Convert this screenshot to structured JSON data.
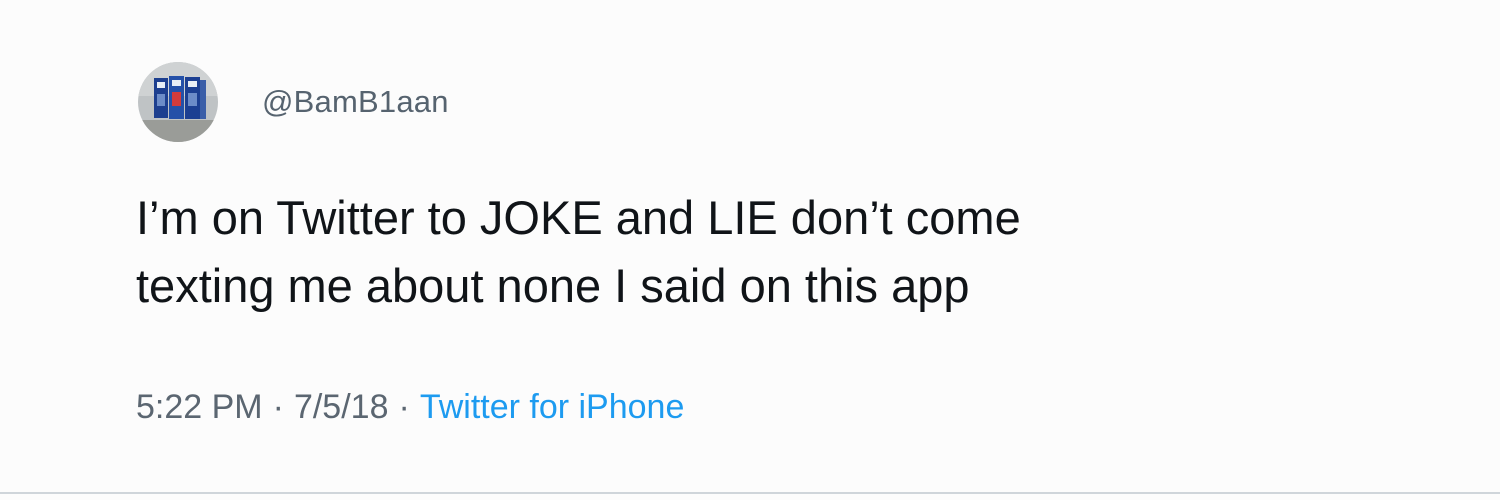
{
  "tweet": {
    "avatar_icon": "profile-photo-vending-machines",
    "handle": "@BamB1aan",
    "text_lines": [
      "I’m on Twitter to JOKE and LIE don’t come",
      "texting me about none I said on this app"
    ],
    "time": "5:22 PM",
    "separator": "·",
    "date": "7/5/18",
    "source": "Twitter for iPhone"
  },
  "colors": {
    "background": "#fcfcfc",
    "text": "#101418",
    "secondary_text": "#5b6671",
    "link": "#1d9bf0"
  }
}
